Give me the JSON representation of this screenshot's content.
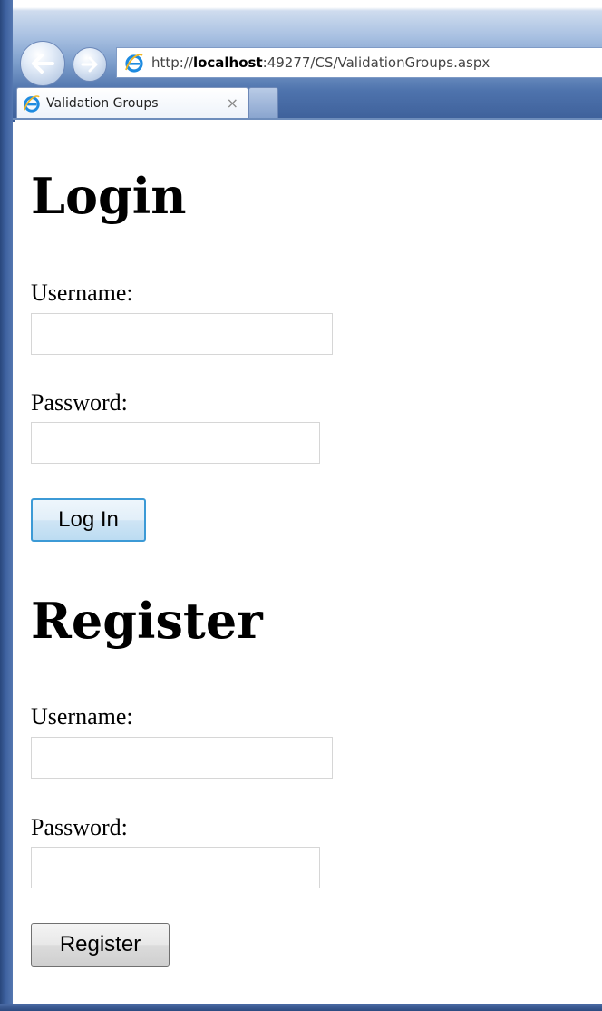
{
  "browser": {
    "address": {
      "scheme": "http://",
      "host": "localhost",
      "rest": ":49277/CS/ValidationGroups.aspx"
    },
    "tab": {
      "title": "Validation Groups",
      "close_glyph": "×"
    },
    "icons": [
      "back-arrow-icon",
      "forward-arrow-icon",
      "ie-logo-icon",
      "close-icon"
    ]
  },
  "login": {
    "heading": "Login",
    "username_label": "Username:",
    "username_value": "",
    "password_label": "Password:",
    "password_value": "",
    "button": "Log In"
  },
  "register": {
    "heading": "Register",
    "username_label": "Username:",
    "username_value": "",
    "password_label": "Password:",
    "password_value": "",
    "button": "Register"
  },
  "colors": {
    "chrome_blue": "#4e73ad",
    "focus_blue": "#3c9ad6"
  }
}
